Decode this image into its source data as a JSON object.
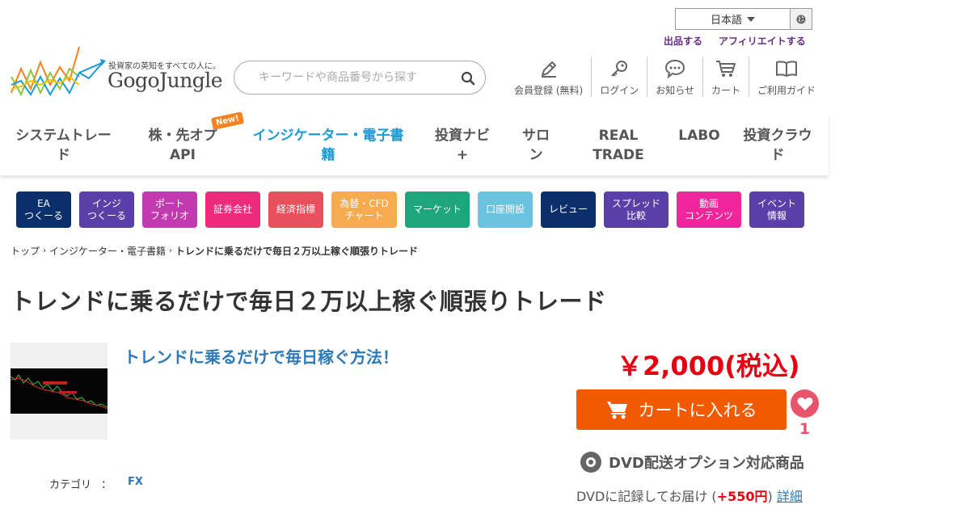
{
  "language": {
    "selected": "日本語"
  },
  "top_links": {
    "sell": "出品する",
    "affiliate": "アフィリエイトする"
  },
  "logo": {
    "tagline": "投資家の英知をすべての人に。",
    "name": "GogoJungle"
  },
  "search": {
    "placeholder": "キーワードや商品番号から探す"
  },
  "user_nav": [
    {
      "label": "会員登録 (無料)",
      "icon": "pencil-icon"
    },
    {
      "label": "ログイン",
      "icon": "key-icon"
    },
    {
      "label": "お知らせ",
      "icon": "chat-bubble-icon"
    },
    {
      "label": "カート",
      "icon": "cart-icon"
    },
    {
      "label": "ご利用ガイド",
      "icon": "book-icon"
    }
  ],
  "main_nav": [
    {
      "label": "システムトレー\nド"
    },
    {
      "label": "株・先オプ\nAPI"
    },
    {
      "label": "インジケーター・電子書\n籍"
    },
    {
      "label": "投資ナビ\n+"
    },
    {
      "label": "サロ\nン"
    },
    {
      "label": "REAL\nTRADE"
    },
    {
      "label": "LABO"
    },
    {
      "label": "投資クラウ\nド"
    }
  ],
  "new_badge": "New!",
  "categories": [
    {
      "label": "EA\nつくーる",
      "color": "#0b2f6b"
    },
    {
      "label": "インジ\nつくーる",
      "color": "#5b3fa8"
    },
    {
      "label": "ポート\nフォリオ",
      "color": "#c13ab0"
    },
    {
      "label": "証券会社",
      "color": "#ee2a7b"
    },
    {
      "label": "経済指標",
      "color": "#e8505b"
    },
    {
      "label": "為替・CFD\nチャート",
      "color": "#f5ab4e"
    },
    {
      "label": "マーケット",
      "color": "#1fa57c"
    },
    {
      "label": "口座開設",
      "color": "#6ac4df"
    },
    {
      "label": "レビュー",
      "color": "#0b2f6b"
    },
    {
      "label": "スプレッド\n比較",
      "color": "#5b3fa8"
    },
    {
      "label": "動画\nコンテンツ",
      "color": "#f0259b"
    },
    {
      "label": "イベント\n情報",
      "color": "#5b3fa8"
    }
  ],
  "breadcrumb": {
    "home": "トップ",
    "category": "インジケーター・電子書籍",
    "current": "トレンドに乗るだけで毎日２万以上稼ぐ順張りトレード"
  },
  "product": {
    "title": "トレンドに乗るだけで毎日２万以上稼ぐ順張りトレード",
    "subtitle": "トレンドに乗るだけで毎日稼ぐ方法！",
    "category_label": "カテゴリ",
    "category_sep": "：",
    "category_value": "FX",
    "price": "￥2,000(税込)",
    "cart_button": "カートに入れる",
    "favorite_count": "1",
    "dvd_title": "DVD配送オプション対応商品",
    "dvd_note_prefix": "DVDに記録してお届け (",
    "dvd_note_amount": "+550円",
    "dvd_note_suffix": ") ",
    "dvd_detail_link": "詳細"
  }
}
